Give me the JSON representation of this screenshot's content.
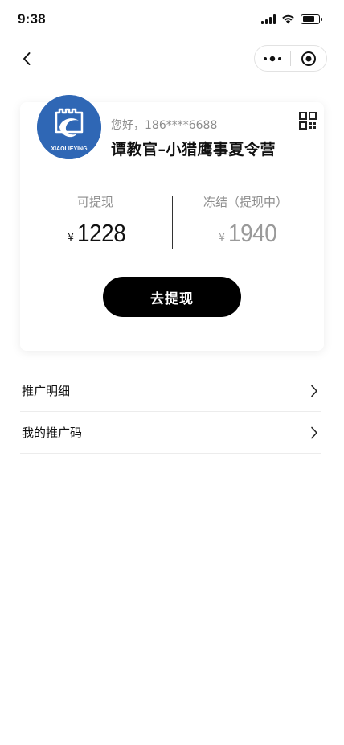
{
  "status_bar": {
    "time": "9:38",
    "icons": [
      "cellular-signal-icon",
      "wifi-icon",
      "battery-icon"
    ]
  },
  "nav": {
    "back_icon": "chevron-left-icon",
    "capsule": {
      "more_icon": "more-dots-icon",
      "close_icon": "target-close-icon"
    }
  },
  "profile": {
    "greeting": "您好，186****6688",
    "name": "谭教官–小猎鹰事夏令营",
    "avatar_text": "XIAOLIEYING",
    "avatar_color": "#2f67b5",
    "qr_icon": "qr-code-icon"
  },
  "balance": {
    "withdrawable_label": "可提现",
    "withdrawable_currency": "¥",
    "withdrawable_amount": "1228",
    "frozen_label": "冻结（提现中）",
    "frozen_currency": "¥",
    "frozen_amount": "1940"
  },
  "actions": {
    "withdraw_label": "去提现"
  },
  "menu": {
    "items": [
      {
        "label": "推广明细",
        "icon": "chevron-right-icon"
      },
      {
        "label": "我的推广码",
        "icon": "chevron-right-icon"
      }
    ]
  }
}
